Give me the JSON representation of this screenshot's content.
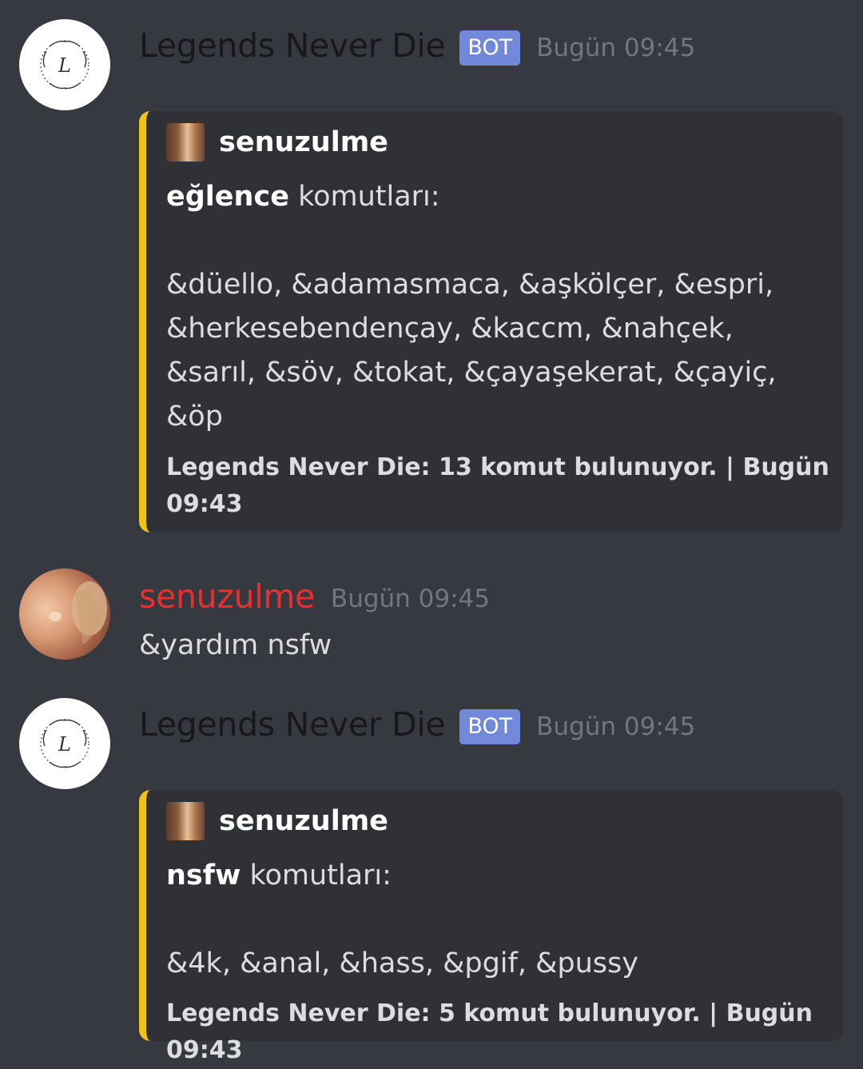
{
  "messages": [
    {
      "author": "Legends Never Die",
      "bot_tag": "BOT",
      "timestamp": "Bugün 09:45",
      "embed": {
        "author_name": "senuzulme",
        "title_bold": "eğlence",
        "title_rest": " komutları:",
        "commands": "&düello, &adamasmaca, &aşkölçer, &espri, &herkesebendençay, &kaccm, &nahçek, &sarıl, &söv, &tokat, &çayaşekerat, &çayiç, &öp",
        "footer": "Legends Never Die: 13 komut bulunuyor. | Bugün 09:43",
        "color": "#f1c40f"
      }
    },
    {
      "author": "senuzulme",
      "author_color": "#ed2e2e",
      "timestamp": "Bugün 09:45",
      "content": "&yardım nsfw"
    },
    {
      "author": "Legends Never Die",
      "bot_tag": "BOT",
      "timestamp": "Bugün 09:45",
      "embed": {
        "author_name": "senuzulme",
        "title_bold": "nsfw",
        "title_rest": " komutları:",
        "commands": "&4k, &anal, &hass, &pgif, &pussy",
        "footer": "Legends Never Die: 5 komut bulunuyor. | Bugün 09:43",
        "color": "#f1c40f"
      }
    }
  ],
  "icons": {
    "bot_avatar": "wreath-logo-icon",
    "embed_author": "user-thumbnail-icon"
  },
  "colors": {
    "background": "#36393f",
    "embed_background": "#2f3136",
    "bot_tag": "#7289da"
  }
}
